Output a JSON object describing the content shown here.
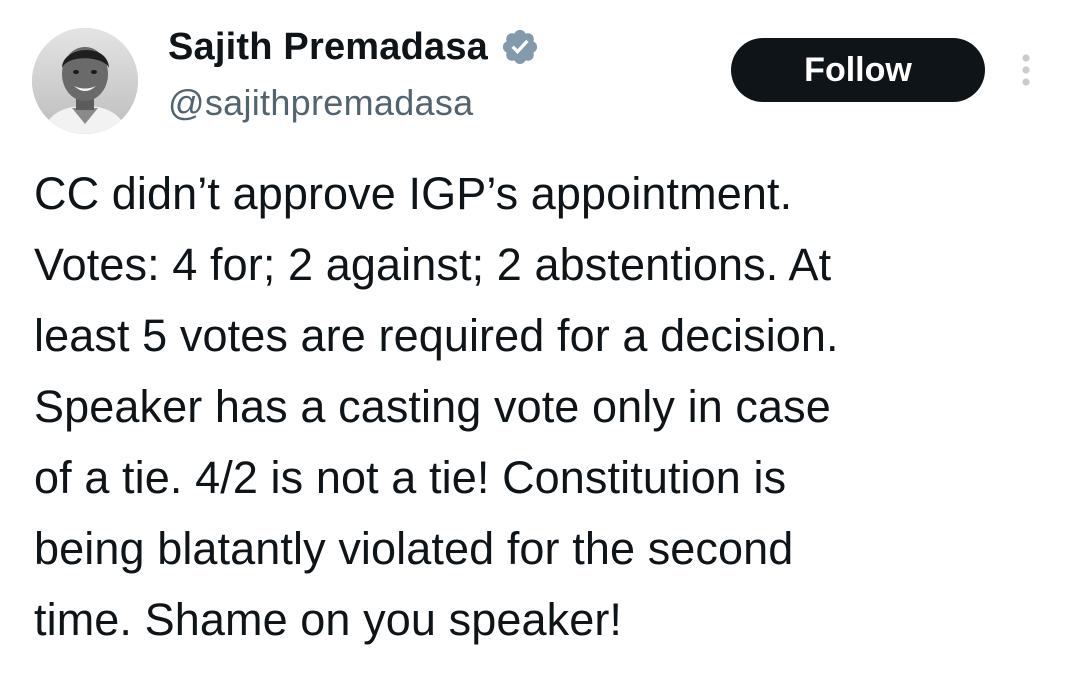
{
  "author": {
    "display_name": "Sajith Premadasa",
    "handle": "@sajithpremadasa",
    "verified": true
  },
  "actions": {
    "follow_label": "Follow"
  },
  "icons": {
    "verified": "verified-badge-icon",
    "more": "more-vertical-icon"
  },
  "colors": {
    "text": "#0f1419",
    "secondary_text": "#536471",
    "follow_bg": "#0f1419",
    "follow_text": "#ffffff",
    "verified_badge": "#829aab"
  },
  "tweet": {
    "text": "CC didn’t approve IGP’s appointment.\nVotes: 4 for; 2 against; 2 abstentions. At\nleast 5 votes are required for a decision.\nSpeaker has a casting vote only in case\nof a tie. 4/2 is not a tie! Constitution is\nbeing blatantly violated for the second\ntime. Shame on you speaker!"
  }
}
